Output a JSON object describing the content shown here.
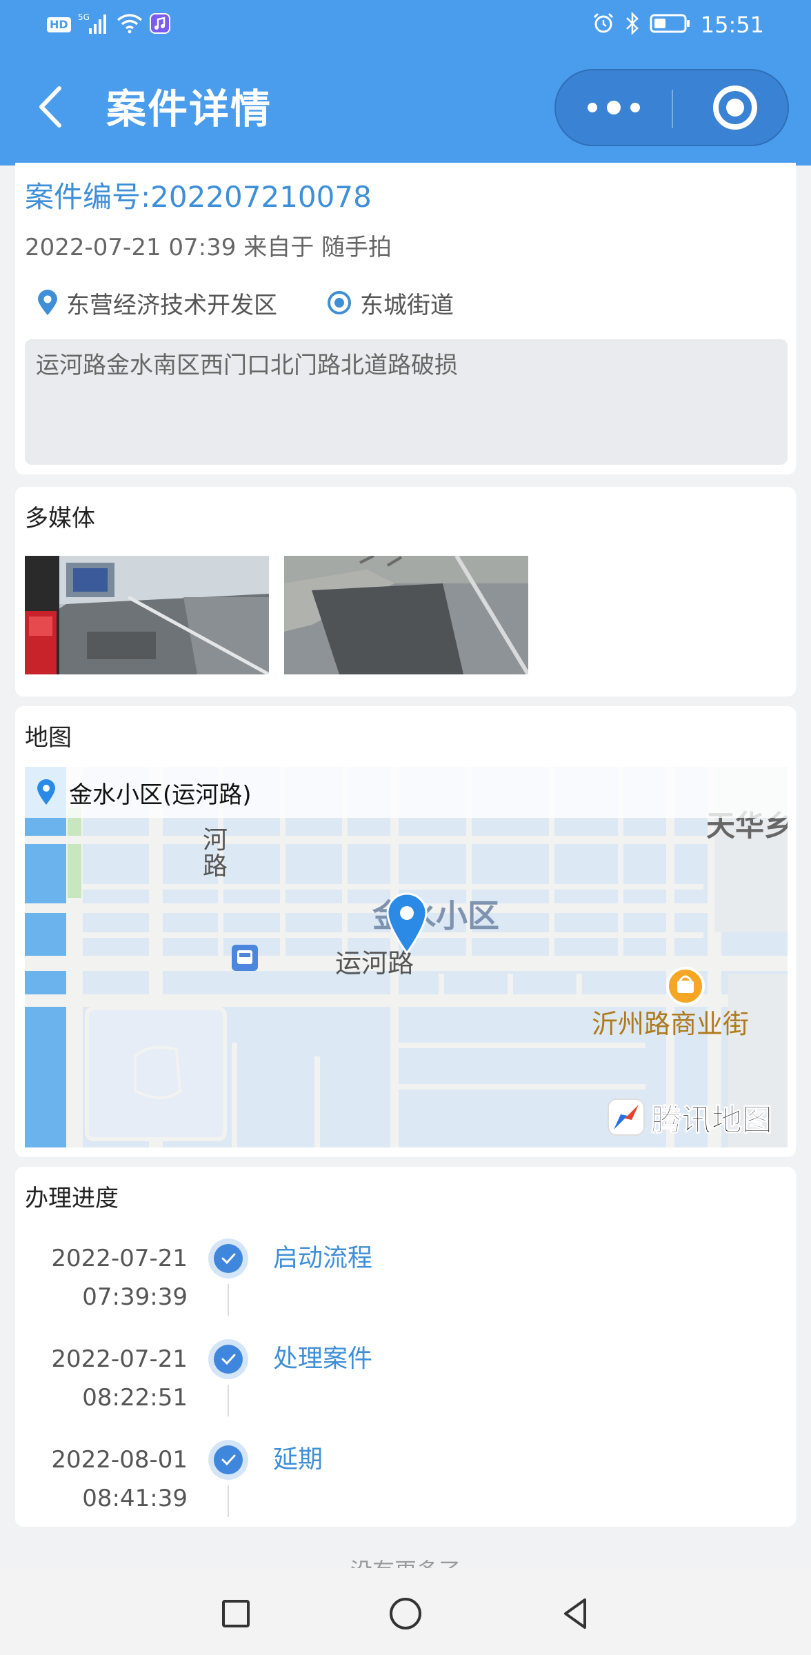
{
  "status_bar": {
    "network_badge": "HD",
    "network_type": "5G",
    "time": "15:51"
  },
  "header": {
    "title": "案件详情",
    "icons": [
      "back-arrow-icon",
      "more-dots-icon",
      "target-circle-icon"
    ]
  },
  "case": {
    "number": "案件编号:202207210078",
    "meta": "2022-07-21 07:39 来自于 随手拍",
    "district": "东营经济技术开发区",
    "street": "东城街道",
    "description": "运河路金水南区西门口北门路北道路破损"
  },
  "media": {
    "title": "多媒体"
  },
  "map": {
    "title": "地图",
    "location_label": "金水小区(运河路)",
    "labels": [
      "河",
      "路",
      "金水小区",
      "运河路",
      "沂州路商业街",
      "天华乡"
    ],
    "logo_text": "腾讯地图"
  },
  "progress": {
    "title": "办理进度",
    "steps": [
      {
        "date": "2022-07-21",
        "time": "07:39:39",
        "label": "启动流程"
      },
      {
        "date": "2022-07-21",
        "time": "08:22:51",
        "label": "处理案件"
      },
      {
        "date": "2022-08-01",
        "time": "08:41:39",
        "label": "延期"
      }
    ]
  },
  "footer": {
    "hint": "没有更多了"
  },
  "colors": {
    "header_bg": "#4a9cec",
    "accent": "#3f8fd8",
    "page_bg": "#f1f2f4"
  }
}
